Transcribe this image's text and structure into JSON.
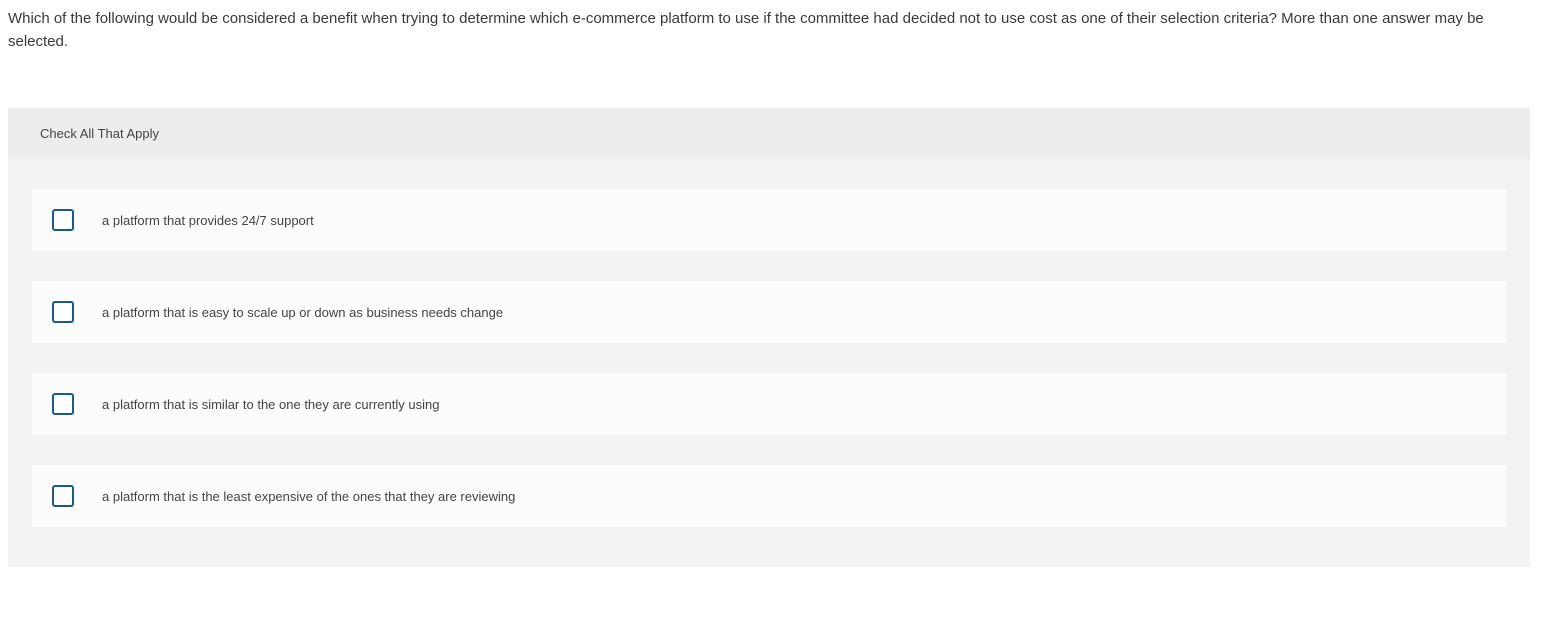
{
  "question": {
    "text": "Which of the following would be considered a benefit when trying to determine which e-commerce platform to use if the committee had decided not to use cost as one of their selection criteria? More than one answer may be selected."
  },
  "instruction": "Check All That Apply",
  "options": [
    {
      "label": "a platform that provides 24/7 support"
    },
    {
      "label": "a platform that is easy to scale up or down as business needs change"
    },
    {
      "label": "a platform that is similar to the one they are currently using"
    },
    {
      "label": "a platform that is the least expensive of the ones that they are reviewing"
    }
  ]
}
